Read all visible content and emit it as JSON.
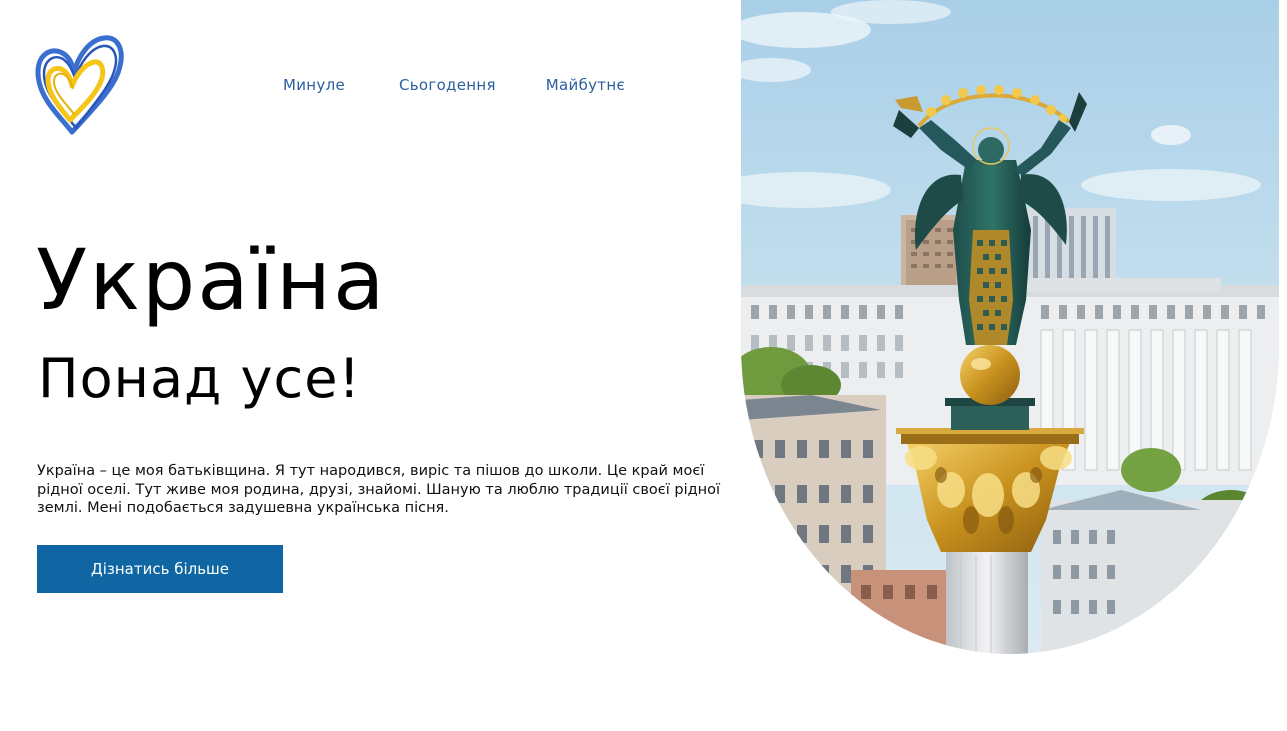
{
  "nav": {
    "items": [
      "Минуле",
      "Сьогодення",
      "Майбутнє"
    ]
  },
  "hero": {
    "title": "Україна",
    "subtitle": "Понад усе!",
    "description": "Україна – це моя батьківщина. Я тут народився, виріс та пішов до школи. Це край моєї рідної оселі. Тут живе моя родина, друзі, знайомі. Шаную та люблю традиції своєї рідної землі. Мені подобається задушевна українська пісня.",
    "cta_label": "Дізнатись більше"
  },
  "colors": {
    "accent_blue": "#0f66a3",
    "nav_blue": "#2a5f9e",
    "flag_blue": "#3a6fd0",
    "flag_yellow": "#f5c517"
  },
  "icons": {
    "logo": "heart-logo-icon"
  }
}
